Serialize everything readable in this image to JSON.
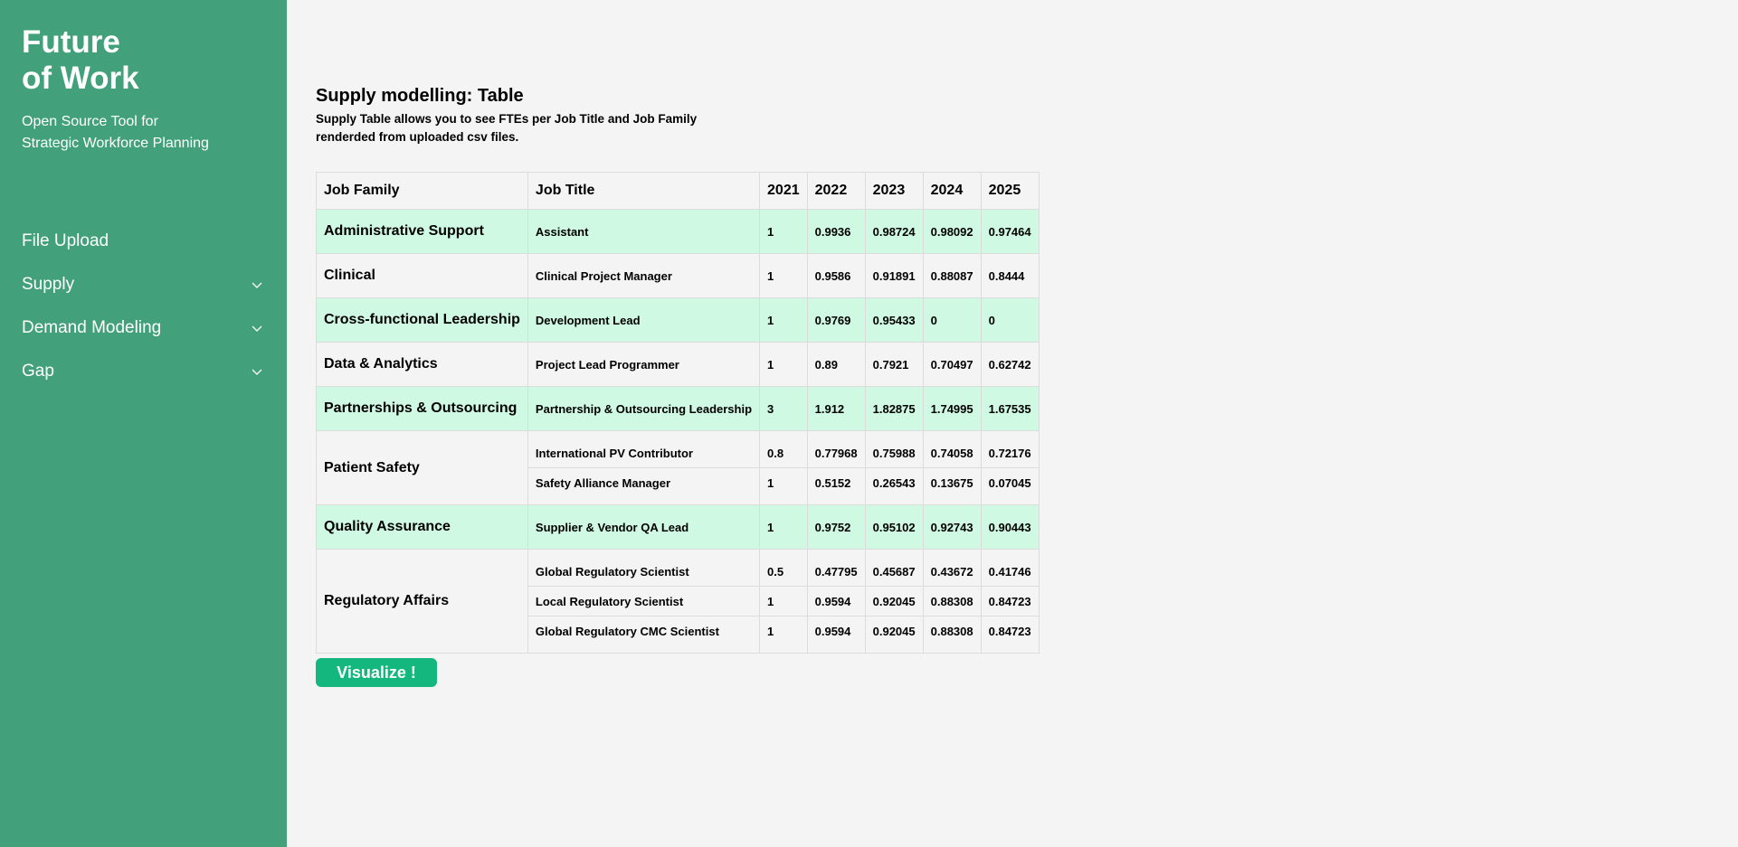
{
  "brand": {
    "title_line1": "Future",
    "title_line2": "of Work",
    "subtitle_line1": "Open Source Tool for",
    "subtitle_line2": "Strategic Workforce Planning"
  },
  "nav": {
    "file_upload": "File Upload",
    "supply": "Supply",
    "demand": "Demand Modeling",
    "gap": "Gap",
    "chevron_icon": "chevron-down-icon"
  },
  "page": {
    "title": "Supply modelling: Table",
    "desc_line1": "Supply Table allows you to see FTEs per Job Title and Job Family",
    "desc_line2": "renderded from uploaded csv files."
  },
  "table": {
    "headers": [
      "Job Family",
      "Job Title",
      "2021",
      "2022",
      "2023",
      "2024",
      "2025"
    ],
    "groups": [
      {
        "family": "Administrative Support",
        "rows": [
          {
            "title": "Assistant",
            "values": [
              "1",
              "0.9936",
              "0.98724",
              "0.98092",
              "0.97464"
            ]
          }
        ]
      },
      {
        "family": "Clinical",
        "rows": [
          {
            "title": "Clinical Project Manager",
            "values": [
              "1",
              "0.9586",
              "0.91891",
              "0.88087",
              "0.8444"
            ]
          }
        ]
      },
      {
        "family": "Cross-functional Leadership",
        "rows": [
          {
            "title": "Development Lead",
            "values": [
              "1",
              "0.9769",
              "0.95433",
              "0",
              "0"
            ]
          }
        ]
      },
      {
        "family": "Data & Analytics",
        "rows": [
          {
            "title": "Project Lead Programmer",
            "values": [
              "1",
              "0.89",
              "0.7921",
              "0.70497",
              "0.62742"
            ]
          }
        ]
      },
      {
        "family": "Partnerships & Outsourcing",
        "rows": [
          {
            "title": "Partnership & Outsourcing Leadership",
            "values": [
              "3",
              "1.912",
              "1.82875",
              "1.74995",
              "1.67535"
            ]
          }
        ]
      },
      {
        "family": "Patient Safety",
        "rows": [
          {
            "title": "International PV Contributor",
            "values": [
              "0.8",
              "0.77968",
              "0.75988",
              "0.74058",
              "0.72176"
            ]
          },
          {
            "title": "Safety Alliance Manager",
            "values": [
              "1",
              "0.5152",
              "0.26543",
              "0.13675",
              "0.07045"
            ]
          }
        ]
      },
      {
        "family": "Quality Assurance",
        "rows": [
          {
            "title": "Supplier & Vendor QA Lead",
            "values": [
              "1",
              "0.9752",
              "0.95102",
              "0.92743",
              "0.90443"
            ]
          }
        ]
      },
      {
        "family": "Regulatory Affairs",
        "rows": [
          {
            "title": "Global Regulatory Scientist",
            "values": [
              "0.5",
              "0.47795",
              "0.45687",
              "0.43672",
              "0.41746"
            ]
          },
          {
            "title": "Local Regulatory Scientist",
            "values": [
              "1",
              "0.9594",
              "0.92045",
              "0.88308",
              "0.84723"
            ]
          },
          {
            "title": "Global Regulatory CMC Scientist",
            "values": [
              "1",
              "0.9594",
              "0.92045",
              "0.88308",
              "0.84723"
            ]
          }
        ]
      }
    ]
  },
  "visualize_button": "Visualize !",
  "colors": {
    "sidebar": "#42a17a",
    "row_highlight": "#cff9e3",
    "button": "#14b87f",
    "background": "#f4f4f4"
  }
}
